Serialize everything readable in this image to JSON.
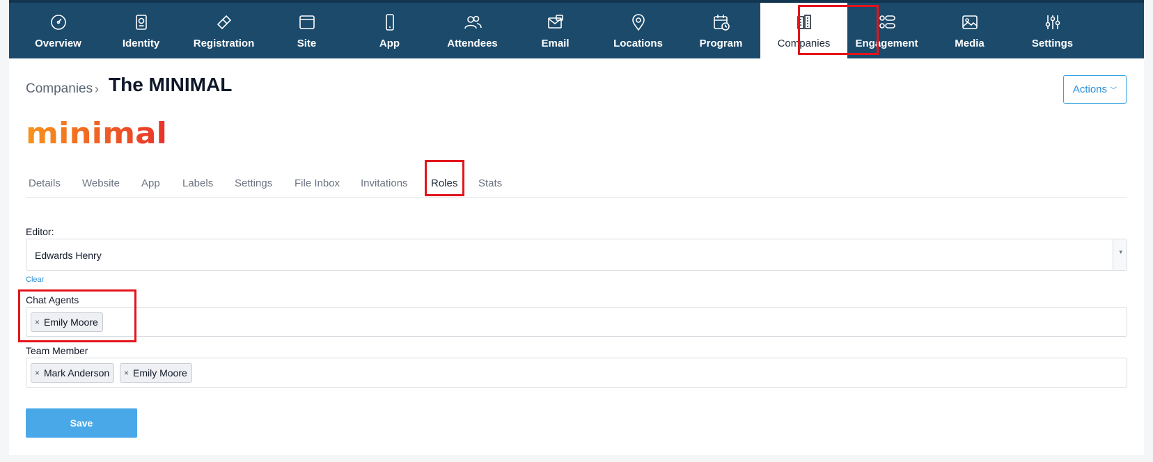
{
  "nav": {
    "items": [
      {
        "label": "Overview",
        "icon": "gauge-icon"
      },
      {
        "label": "Identity",
        "icon": "passport-icon"
      },
      {
        "label": "Registration",
        "icon": "ticket-icon"
      },
      {
        "label": "Site",
        "icon": "browser-icon"
      },
      {
        "label": "App",
        "icon": "phone-icon"
      },
      {
        "label": "Attendees",
        "icon": "users-icon"
      },
      {
        "label": "Email",
        "icon": "email-icon"
      },
      {
        "label": "Locations",
        "icon": "map-pin-icon"
      },
      {
        "label": "Program",
        "icon": "calendar-clock-icon"
      },
      {
        "label": "Companies",
        "icon": "building-icon",
        "active": true
      },
      {
        "label": "Engagement",
        "icon": "engagement-icon"
      },
      {
        "label": "Media",
        "icon": "image-icon"
      },
      {
        "label": "Settings",
        "icon": "sliders-icon"
      }
    ]
  },
  "header": {
    "breadcrumb": "Companies",
    "separator": "›",
    "title": "The MINIMAL",
    "actions_label": "Actions"
  },
  "logo_text": "minimal",
  "tabs": [
    "Details",
    "Website",
    "App",
    "Labels",
    "Settings",
    "File Inbox",
    "Invitations",
    "Roles",
    "Stats"
  ],
  "active_tab": "Roles",
  "form": {
    "editor_label": "Editor:",
    "editor_value": "Edwards Henry",
    "clear_label": "Clear",
    "chat_agents_label": "Chat Agents",
    "chat_agents": [
      "Emily Moore"
    ],
    "team_member_label": "Team Member",
    "team_members": [
      "Mark Anderson",
      "Emily Moore"
    ],
    "tag_remove_glyph": "×",
    "select_arrow_glyph": "▾",
    "save_label": "Save"
  },
  "colors": {
    "nav_bg": "#1b4a6b",
    "highlight": "#e3141b",
    "accent": "#2a8fd6",
    "save_bg": "#49a8e8"
  }
}
